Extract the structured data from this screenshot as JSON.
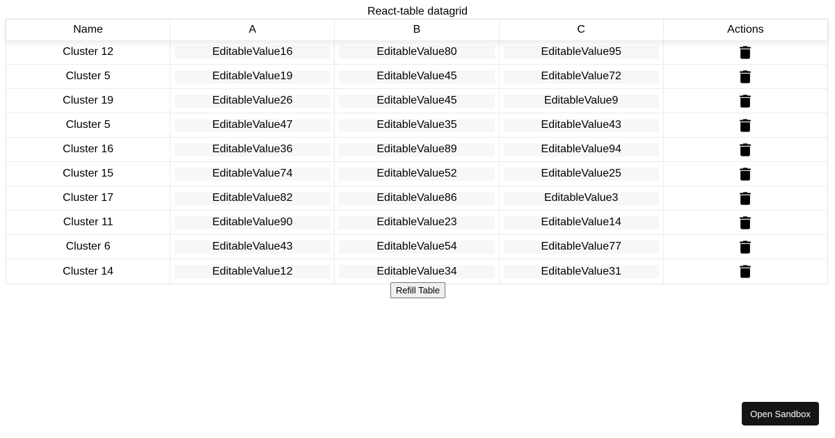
{
  "title": "React-table datagrid",
  "table": {
    "headers": [
      "Name",
      "A",
      "B",
      "C",
      "Actions"
    ],
    "rows": [
      {
        "name": "Cluster 12",
        "a": "EditableValue16",
        "b": "EditableValue80",
        "c": "EditableValue95"
      },
      {
        "name": "Cluster 5",
        "a": "EditableValue19",
        "b": "EditableValue45",
        "c": "EditableValue72"
      },
      {
        "name": "Cluster 19",
        "a": "EditableValue26",
        "b": "EditableValue45",
        "c": "EditableValue9"
      },
      {
        "name": "Cluster 5",
        "a": "EditableValue47",
        "b": "EditableValue35",
        "c": "EditableValue43"
      },
      {
        "name": "Cluster 16",
        "a": "EditableValue36",
        "b": "EditableValue89",
        "c": "EditableValue94"
      },
      {
        "name": "Cluster 15",
        "a": "EditableValue74",
        "b": "EditableValue52",
        "c": "EditableValue25"
      },
      {
        "name": "Cluster 17",
        "a": "EditableValue82",
        "b": "EditableValue86",
        "c": "EditableValue3"
      },
      {
        "name": "Cluster 11",
        "a": "EditableValue90",
        "b": "EditableValue23",
        "c": "EditableValue14"
      },
      {
        "name": "Cluster 6",
        "a": "EditableValue43",
        "b": "EditableValue54",
        "c": "EditableValue77"
      },
      {
        "name": "Cluster 14",
        "a": "EditableValue12",
        "b": "EditableValue34",
        "c": "EditableValue31"
      }
    ],
    "row_action_icon": "trash-icon"
  },
  "buttons": {
    "refill_label": "Refill Table",
    "sandbox_label": "Open Sandbox"
  },
  "colors": {
    "sandbox_bg": "#151515",
    "cell_input_bg": "#f7f7f7",
    "border": "#ececec"
  }
}
